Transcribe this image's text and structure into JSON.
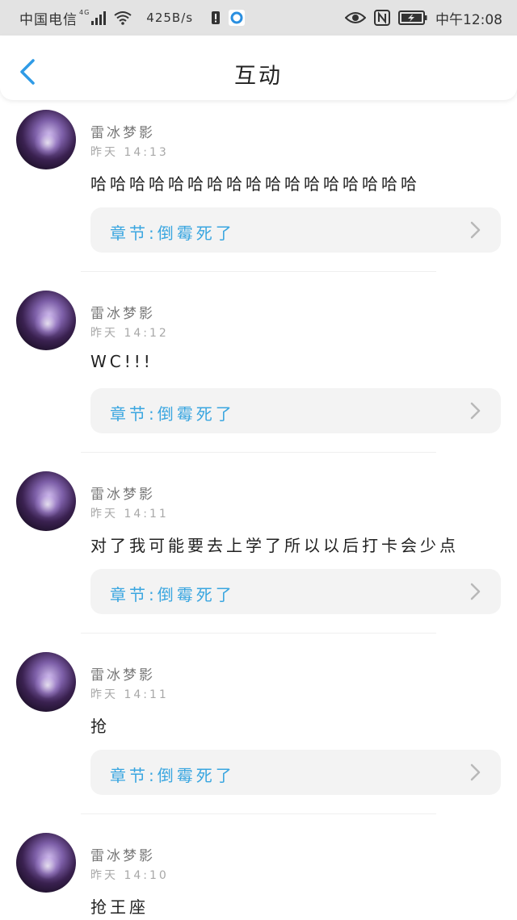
{
  "status_bar": {
    "carrier": "中国电信",
    "network": "4G",
    "speed": "425B/s",
    "time": "中午12:08"
  },
  "header": {
    "title": "互动"
  },
  "posts": [
    {
      "name": "雷冰梦影",
      "time": "昨天 14:13",
      "content": "哈哈哈哈哈哈哈哈哈哈哈哈哈哈哈哈哈",
      "chapter": "章节:倒霉死了"
    },
    {
      "name": "雷冰梦影",
      "time": "昨天 14:12",
      "content": "WC!!!",
      "chapter": "章节:倒霉死了"
    },
    {
      "name": "雷冰梦影",
      "time": "昨天 14:11",
      "content": "对了我可能要去上学了所以以后打卡会少点",
      "chapter": "章节:倒霉死了"
    },
    {
      "name": "雷冰梦影",
      "time": "昨天 14:11",
      "content": "抢",
      "chapter": "章节:倒霉死了"
    },
    {
      "name": "雷冰梦影",
      "time": "昨天 14:10",
      "content": "抢王座",
      "chapter": ""
    }
  ],
  "colors": {
    "accent": "#3aa6e0",
    "status_bar_bg": "#e3e3e3",
    "chapter_bg": "#f3f3f3"
  }
}
